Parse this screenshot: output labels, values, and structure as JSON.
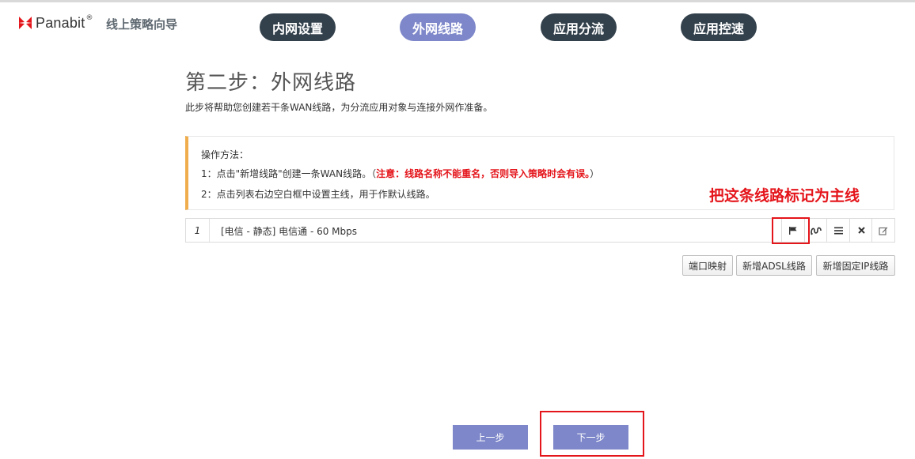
{
  "header": {
    "logo_text": "Panabit",
    "logo_registered": "®",
    "wizard_title": "线上策略向导"
  },
  "nav": {
    "tabs": [
      {
        "label": "内网设置",
        "active": false
      },
      {
        "label": "外网线路",
        "active": true
      },
      {
        "label": "应用分流",
        "active": false
      },
      {
        "label": "应用控速",
        "active": false
      }
    ]
  },
  "step": {
    "title": "第二步：外网线路",
    "description": "此步将帮助您创建若干条WAN线路，为分流应用对象与连接外网作准备。"
  },
  "instructions": {
    "heading": "操作方法：",
    "line1_prefix": "1：点击\"新增线路\"创建一条WAN线路。（",
    "line1_warning": "注意：线路名称不能重名，否则导入策略时会有误。",
    "line1_suffix": "）",
    "line2": "2：点击列表右边空白框中设置主线，用于作默认线路。"
  },
  "annotation": "把这条线路标记为主线",
  "lines": [
    {
      "index": "1",
      "text": "[电信 - 静态] 电信通 - 60 Mbps"
    }
  ],
  "row_actions": {
    "icons": [
      "flag-icon",
      "chart-icon",
      "list-icon",
      "delete-icon",
      "edit-icon"
    ]
  },
  "actions": {
    "port_mapping": "端口映射",
    "add_adsl": "新增ADSL线路",
    "add_static": "新增固定IP线路"
  },
  "footer": {
    "prev": "上一步",
    "next": "下一步"
  },
  "colors": {
    "nav_dark": "#33414c",
    "nav_active": "#7d87c9",
    "warning_red": "#e4151b",
    "instruction_accent": "#f0ad4e",
    "footer_button": "#7d87c9"
  }
}
